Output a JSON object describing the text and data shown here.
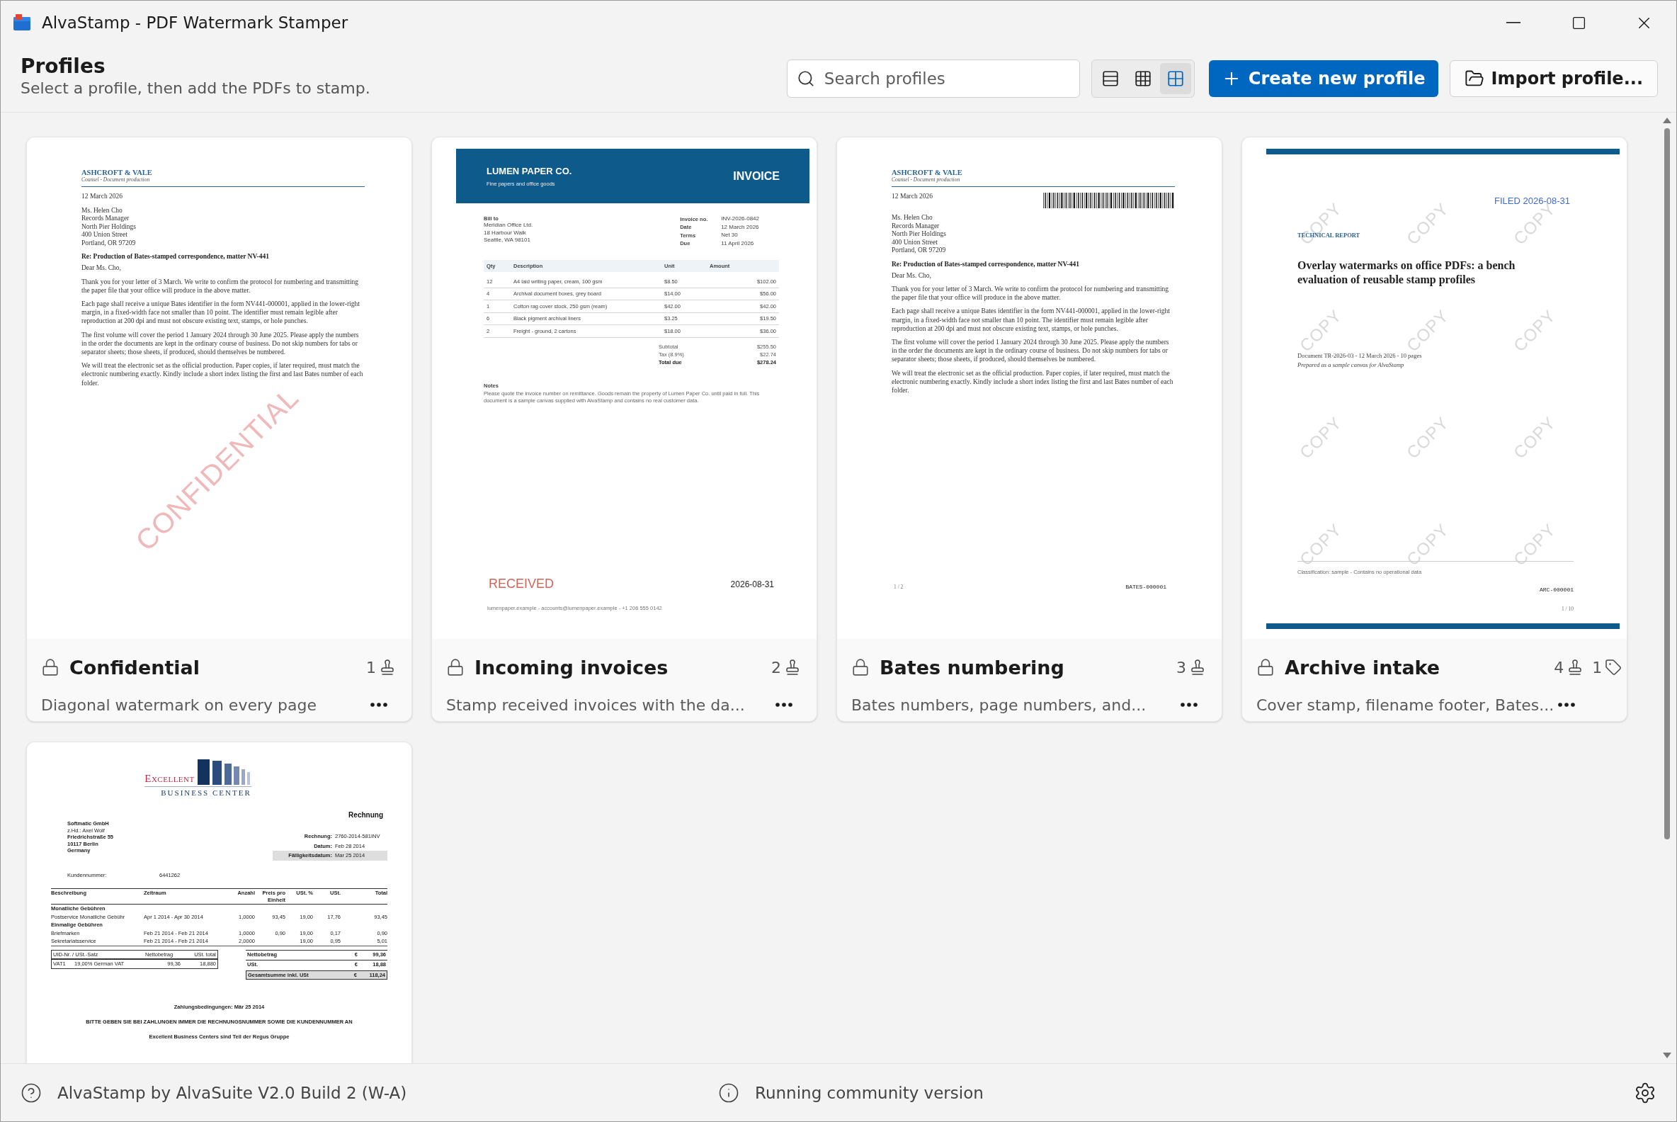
{
  "window": {
    "title": "AlvaStamp - PDF Watermark Stamper"
  },
  "header": {
    "title": "Profiles",
    "subtitle": "Select a profile, then add the PDFs to stamp.",
    "search": {
      "placeholder": "Search profiles"
    },
    "view_modes": [
      {
        "kind": "list",
        "selected": false
      },
      {
        "kind": "table",
        "selected": false
      },
      {
        "kind": "tiles",
        "selected": true
      }
    ],
    "create_button": "Create new profile",
    "import_button": "Import profile..."
  },
  "profiles": [
    {
      "title": "Confidential",
      "description": "Diagonal watermark on every page",
      "stamps": "1",
      "preview": {
        "kind": "letter",
        "firm": "ASHCROFT & VALE",
        "tagline": "Counsel  -  Document production",
        "date": "12 March 2026",
        "address": [
          "Ms. Helen Cho",
          "Records Manager",
          "North Pier Holdings",
          "400 Union Street",
          "Portland, OR 97209"
        ],
        "subject": "Re:  Production of Bates-stamped correspondence, matter NV-441",
        "salutation": "Dear Ms. Cho,",
        "paragraphs": [
          "Thank you for your letter of 3 March. We write to confirm the protocol for numbering and transmitting the paper file that your office will produce in the above matter.",
          "Each page shall receive a unique Bates identifier in the form NV441-000001, applied in the lower-right margin, in a fixed-width face not smaller than 10 point. The identifier must remain legible after reproduction at 200 dpi and must not obscure existing text, stamps, or hole punches.",
          "The first volume will cover the period 1 January 2024 through 30 June 2025. Please apply the numbers in the order the documents are kept in the ordinary course of business. Do not skip numbers for tabs or separator sheets; those sheets, if produced, should themselves be numbered.",
          "We will treat the electronic set as the official production. Paper copies, if later required, must match the electronic numbering exactly. Kindly include a short index listing the first and last Bates number of each folder."
        ],
        "stamp": "CONFIDENTIAL"
      }
    },
    {
      "title": "Incoming invoices",
      "description": "Stamp received invoices with the da...",
      "stamps": "2",
      "preview": {
        "kind": "invoice",
        "company": "LUMEN PAPER CO.",
        "tagline": "Fine papers and office goods",
        "heading": "INVOICE",
        "bill_label": "Bill to",
        "bill_to": [
          "Meridian Office Ltd.",
          "18 Harbour Walk",
          "Seattle, WA 98101"
        ],
        "meta": [
          {
            "label": "Invoice no.",
            "value": "INV-2026-0842"
          },
          {
            "label": "Date",
            "value": "12 March 2026"
          },
          {
            "label": "Terms",
            "value": "Net 30"
          },
          {
            "label": "Due",
            "value": "11 April 2026"
          }
        ],
        "columns": [
          "Qty",
          "Description",
          "Unit",
          "Amount"
        ],
        "rows": [
          [
            "12",
            "A4 laid writing paper, cream, 100 gsm",
            "$8.50",
            "$102.00"
          ],
          [
            "4",
            "Archival document boxes, grey board",
            "$14.00",
            "$56.00"
          ],
          [
            "1",
            "Cotton rag cover stock, 250 gsm (ream)",
            "$42.00",
            "$42.00"
          ],
          [
            "6",
            "Black pigment archival liners",
            "$3.25",
            "$19.50"
          ],
          [
            "2",
            "Freight - ground, 2 cartons",
            "$18.00",
            "$36.00"
          ]
        ],
        "totals": [
          {
            "label": "Subtotal",
            "value": "$255.50",
            "bold": false
          },
          {
            "label": "Tax (8.9%)",
            "value": "$22.74",
            "bold": false
          },
          {
            "label": "Total due",
            "value": "$278.24",
            "bold": true
          }
        ],
        "notes_label": "Notes",
        "notes": "Please quote the invoice number on remittance. Goods remain the property of Lumen Paper Co. until paid in full. This document is a sample canvas supplied with AlvaStamp and contains no real customer data.",
        "stamp": "RECEIVED",
        "stamp_date": "2026-08-31",
        "footer": "lumenpaper.example  -  accounts@lumenpaper.example  -  +1 206 555 0142"
      }
    },
    {
      "title": "Bates numbering",
      "description": "Bates numbers, page numbers, and...",
      "stamps": "3",
      "preview": {
        "kind": "letter",
        "firm": "ASHCROFT & VALE",
        "tagline": "Counsel  -  Document production",
        "date": "12 March 2026",
        "barcode": true,
        "address": [
          "Ms. Helen Cho",
          "Records Manager",
          "North Pier Holdings",
          "400 Union Street",
          "Portland, OR 97209"
        ],
        "subject": "Re:  Production of Bates-stamped correspondence, matter NV-441",
        "salutation": "Dear Ms. Cho,",
        "paragraphs": [
          "Thank you for your letter of 3 March. We write to confirm the protocol for numbering and transmitting the paper file that your office will produce in the above matter.",
          "Each page shall receive a unique Bates identifier in the form NV441-000001, applied in the lower-right margin, in a fixed-width face not smaller than 10 point. The identifier must remain legible after reproduction at 200 dpi and must not obscure existing text, stamps, or hole punches.",
          "The first volume will cover the period 1 January 2024 through 30 June 2025. Please apply the numbers in the order the documents are kept in the ordinary course of business. Do not skip numbers for tabs or separator sheets; those sheets, if produced, should themselves be numbered.",
          "We will treat the electronic set as the official production. Paper copies, if later required, must match the electronic numbering exactly. Kindly include a short index listing the first and last Bates number of each folder."
        ],
        "page": "1 / 2",
        "bates": "BATES-000001"
      }
    },
    {
      "title": "Archive intake",
      "description": "Cover stamp, filename footer, Bates...",
      "stamps": "4",
      "tags": "1",
      "preview": {
        "kind": "report",
        "filed": "FILED 2026-08-31",
        "label": "TECHNICAL REPORT",
        "title": "Overlay watermarks on office PDFs: a bench evaluation of reusable stamp profiles",
        "meta": "Document TR-2026-03  -  12 March 2026  -  10 pages",
        "prepared": "Prepared as a sample canvas for AlvaStamp",
        "watermarks": [
          "COPY",
          "COPY",
          "COPY",
          "COPY",
          "COPY",
          "COPY",
          "COPY",
          "COPY",
          "COPY",
          "COPY",
          "COPY",
          "COPY"
        ],
        "classification": "Classification: sample  -  Contains no operational data",
        "bates": "ARC-000001",
        "page": "1 / 10"
      }
    },
    {
      "preview": {
        "kind": "rechnung",
        "logo_top": "Excellent",
        "logo_bottom": "BUSINESS CENTER",
        "heading": "Rechnung",
        "recipient": [
          "Softmatic GmbH",
          "z.Hd.:  Axel Wolf",
          "Friedrichstraße 55",
          "10117 Berlin",
          "Germany"
        ],
        "meta": [
          {
            "label": "Rechnung:",
            "value": "2760-2014-581INV",
            "shaded": false
          },
          {
            "label": "Datum:",
            "value": "Feb 28 2014",
            "shaded": false
          },
          {
            "label": "Fälligkeitsdatum:",
            "value": "Mar 25 2014",
            "shaded": true
          }
        ],
        "customer_label": "Kundennummer:",
        "customer": "6441262",
        "columns": [
          "Beschreibung",
          "Zeitraum",
          "Anzahl",
          "Preis pro Einheit",
          "USt. %",
          "USt.",
          "Total"
        ],
        "lines": [
          {
            "kind": "section",
            "cells": [
              "Monatliche Gebühren"
            ]
          },
          {
            "kind": "item",
            "cells": [
              "Postservice Monatliche Gebühr",
              "Apr  1 2014 - Apr 30 2014",
              "1,0000",
              "93,45",
              "19,00",
              "17,76",
              "93,45"
            ]
          },
          {
            "kind": "section",
            "cells": [
              "Einmalige Gebühren"
            ]
          },
          {
            "kind": "item",
            "cells": [
              "Briefmarken",
              "Feb 21 2014 - Feb 21 2014",
              "1,0000",
              "0,90",
              "19,00",
              "0,17",
              "0,90"
            ]
          },
          {
            "kind": "item",
            "cells": [
              "Sekretariatsservice",
              "Feb 21 2014 - Feb 21 2014",
              "2,0000",
              "",
              "19,00",
              "0,95",
              "5,01"
            ]
          }
        ],
        "vat_header": [
          "UID-Nr. / USt.-Satz",
          "Nettobetrag",
          "USt. total"
        ],
        "vat_row": [
          "VAT1",
          "19,00%  German VAT",
          "99,36",
          "18,880"
        ],
        "totals": [
          {
            "label": "Nettobetrag",
            "currency": "€",
            "value": "99,36",
            "shaded": false
          },
          {
            "label": "USt.",
            "currency": "€",
            "value": "18,88",
            "shaded": false
          },
          {
            "label": "Gesamtsumme inkl. USt",
            "currency": "€",
            "value": "118,24",
            "shaded": true
          }
        ],
        "terms": "Zahlungsbedingungen: Mär 25 2014",
        "notice": "BITTE GEBEN SIE BEI ZAHLUNGEN IMMER DIE RECHNUNGSNUMMER SOWIE DIE KUNDENNUMMER AN",
        "closing": "Excellent Business Centers sind Teil der Regus Gruppe"
      }
    }
  ],
  "status_bar": {
    "about": "AlvaStamp by AlvaSuite V2.0 Build 2 (W-A)",
    "status": "Running community version"
  }
}
